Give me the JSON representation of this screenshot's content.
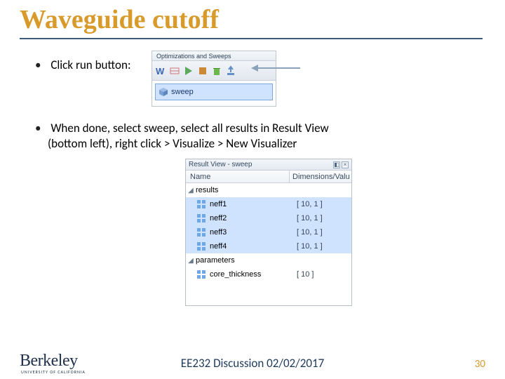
{
  "slide": {
    "title": "Waveguide cutoff",
    "bullet1": "Click run button:",
    "bullet2_line1": "When done, select sweep, select all results in Result View",
    "bullet2_line2": "(bottom left), right click > Visualize > New Visualizer"
  },
  "embed_toolbar": {
    "tab_label": "Optimizations and Sweeps",
    "sweep_label": "sweep"
  },
  "embed_results": {
    "title": "Result View - sweep",
    "col_name": "Name",
    "col_dims": "Dimensions/Valu",
    "results_label": "results",
    "params_label": "parameters",
    "rows": [
      {
        "name": "neff1",
        "dims": "[ 10, 1 ]"
      },
      {
        "name": "neff2",
        "dims": "[ 10, 1 ]"
      },
      {
        "name": "neff3",
        "dims": "[ 10, 1 ]"
      },
      {
        "name": "neff4",
        "dims": "[ 10, 1 ]"
      }
    ],
    "param_row": {
      "name": "core_thickness",
      "dims": "[ 10 ]"
    }
  },
  "footer": {
    "logo_main": "Berkeley",
    "logo_sub": "UNIVERSITY OF CALIFORNIA",
    "center": "EE232 Discussion 02/02/2017",
    "slide_number": "30"
  }
}
